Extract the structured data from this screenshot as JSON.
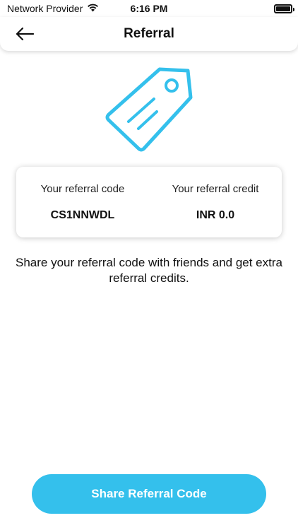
{
  "status_bar": {
    "carrier": "Network Provider",
    "time": "6:16 PM"
  },
  "header": {
    "title": "Referral",
    "back_icon": "arrow-left-icon"
  },
  "illustration": {
    "icon": "price-tag-icon",
    "color": "#34c0ec"
  },
  "referral_card": {
    "code_label": "Your referral code",
    "code_value": "CS1NNWDL",
    "credit_label": "Your referral credit",
    "credit_value": "INR 0.0"
  },
  "description": "Share your referral code with friends and get extra referral credits.",
  "share_button": {
    "label": "Share Referral Code",
    "color": "#34c0ec"
  }
}
